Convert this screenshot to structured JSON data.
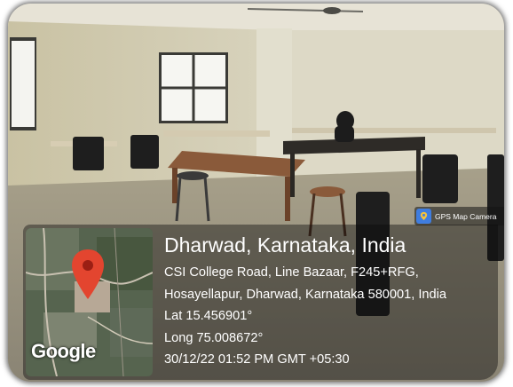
{
  "badge": {
    "label": "GPS Map Camera",
    "icon": "map-pin-camera-icon"
  },
  "map": {
    "provider_logo": "Google",
    "pin_icon": "location-pin-icon",
    "pin_color": "#e3452f"
  },
  "location": {
    "title": "Dharwad, Karnataka, India",
    "address_line1": "CSI College Road, Line Bazaar, F245+RFG,",
    "address_line2": "Hosayellapur, Dharwad, Karnataka 580001, India",
    "latitude": "Lat 15.456901°",
    "longitude": "Long 75.008672°",
    "timestamp": "30/12/22 01:52 PM GMT +05:30"
  }
}
